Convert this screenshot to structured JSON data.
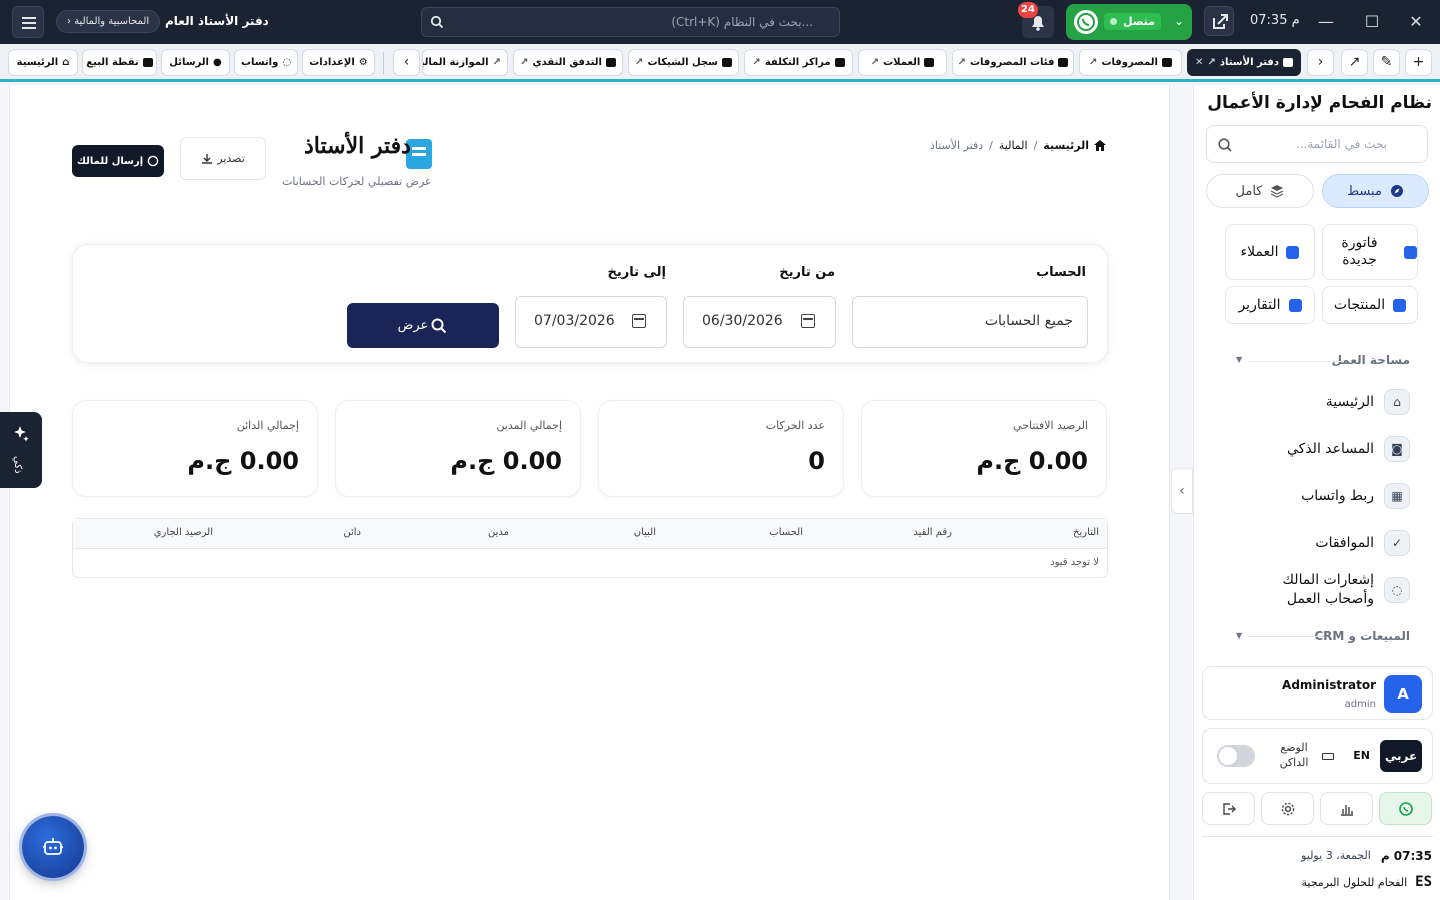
{
  "titlebar": {
    "time": "07:35 م",
    "whatsapp_status": "متصل",
    "notifications_count": "24",
    "search_placeholder": "...بحث في النظام (Ctrl+K)",
    "page_title": "دفتر الأستاذ العام",
    "module_crumb": "المحاسبية والمالية",
    "crumb_chevron": "‹"
  },
  "tabs": {
    "pinned": [
      {
        "label": "الرئيسية",
        "icon": "home-icon"
      },
      {
        "label": "نقطة البيع",
        "icon": "cash-register-icon"
      },
      {
        "label": "الرسائل",
        "icon": "chat-icon"
      },
      {
        "label": "واتساب",
        "icon": "whatsapp-icon"
      },
      {
        "label": "الإعدادات",
        "icon": "gear-icon"
      }
    ],
    "open": [
      {
        "label": "دفتر الأستاذ",
        "active": true
      },
      {
        "label": "المصروفات"
      },
      {
        "label": "فئات المصروفات"
      },
      {
        "label": "العملات"
      },
      {
        "label": "مراكز التكلفة"
      },
      {
        "label": "سجل الشيكات"
      },
      {
        "label": "التدفق النقدي"
      },
      {
        "label": "الموازنة المالية"
      }
    ]
  },
  "page": {
    "breadcrumb": [
      "الرئيسية",
      "المالية",
      "دفتر الأستاذ"
    ],
    "breadcrumb_sep": "/",
    "title": "دفتر الأستاذ",
    "subtitle": "عرض تفصيلي لحركات الحسابات",
    "export_label": "تصدير",
    "send_owner_label": "إرسال للمالك"
  },
  "filters": {
    "account_label": "الحساب",
    "account_value": "جميع الحسابات",
    "from_label": "من تاريخ",
    "from_value": "06/30/2026",
    "to_label": "إلى تاريخ",
    "to_value": "07/03/2026",
    "show_label": "عرض"
  },
  "stats": [
    {
      "label": "الرصيد الافتتاحي",
      "value": "0.00 ج.م"
    },
    {
      "label": "عدد الحركات",
      "value": "0"
    },
    {
      "label": "إجمالي المدين",
      "value": "0.00 ج.م"
    },
    {
      "label": "إجمالي الدائن",
      "value": "0.00 ج.م"
    }
  ],
  "ledger": {
    "columns": [
      "التاريخ",
      "رقم القيد",
      "الحساب",
      "البيان",
      "مدين",
      "دائن",
      "الرصيد الجاري"
    ],
    "empty_text": "لا توجد قيود"
  },
  "ai_tab_label": "ذكي",
  "sidebar": {
    "title": "نظام الفحام لإدارة الأعمال",
    "search_placeholder": "بحث في القائمة...",
    "mode_simple": "مبسط",
    "mode_full": "كامل",
    "quick": [
      {
        "label": "فاتورة جديدة"
      },
      {
        "label": "العملاء"
      },
      {
        "label": "المنتجات"
      },
      {
        "label": "التقارير"
      }
    ],
    "sections": [
      {
        "title": "مساحة العمل"
      },
      {
        "title": "المبيعات و CRM"
      }
    ],
    "workspace": [
      {
        "label": "الرئيسية",
        "icon": "home-icon"
      },
      {
        "label": "المساعد الذكي",
        "icon": "robot-icon"
      },
      {
        "label": "ربط واتساب",
        "icon": "qr-code-icon"
      },
      {
        "label": "الموافقات",
        "icon": "check-circle-icon"
      },
      {
        "label": "إشعارات المالك وأصحاب العمل",
        "icon": "whatsapp-icon"
      }
    ],
    "user": {
      "name": "Administrator",
      "role": "admin",
      "initial": "A"
    },
    "lang_ar": "عربي",
    "lang_en": "EN",
    "dark_mode": "الوضع الداكن",
    "time": "07:35 م",
    "date": "الجمعة، 3 يوليو",
    "company": "الفحام للحلول البرمجية",
    "company_logo": "ES"
  },
  "colors": {
    "titlebar_bg": "#1b2333",
    "accent_teal": "#2cb1c7",
    "primary_button": "#1a2456",
    "whatsapp_green": "#25a244",
    "badge_red": "#ef4444",
    "book_icon_blue": "#2aa7e0"
  }
}
